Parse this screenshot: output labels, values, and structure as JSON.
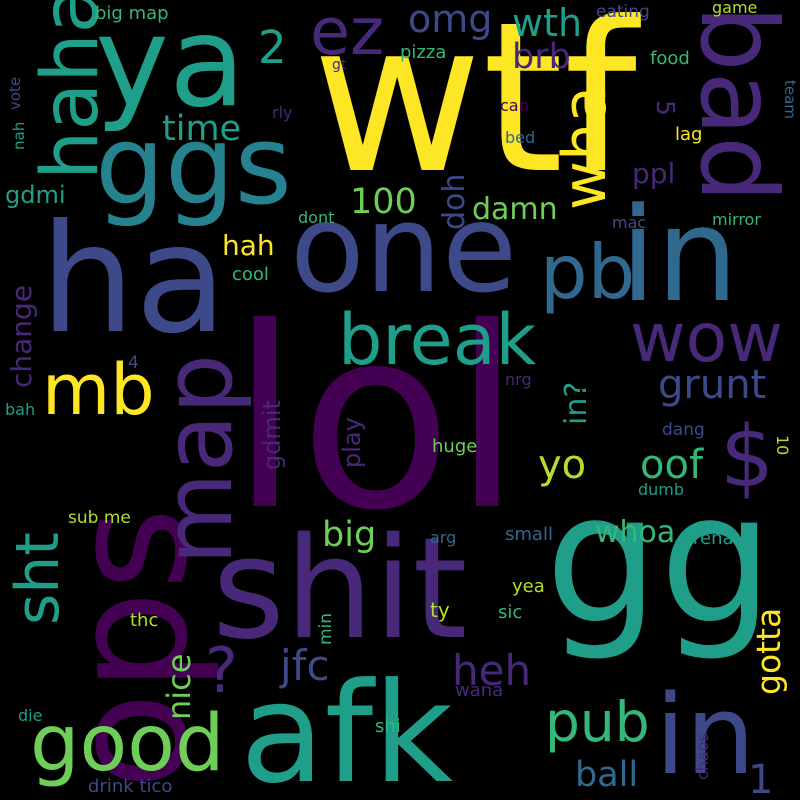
{
  "words": {
    "wtf": "wtf",
    "lol": "lol",
    "gg": "gg",
    "ops": "ops",
    "shit": "shit",
    "afk": "afk",
    "ha": "ha",
    "one": "one",
    "in_top": "in",
    "in_bottom": "in",
    "ya": "ya",
    "ggs": "ggs",
    "bad": "bad",
    "haha": "haha",
    "map": "map",
    "pb": "pb",
    "break": "break",
    "wow": "wow",
    "good": "good",
    "ez": "ez",
    "omg": "omg",
    "wth": "wth",
    "what": "wha",
    "mb": "mb",
    "dollar": "$",
    "sht": "sht",
    "pub": "pub",
    "jfc": "jfc",
    "question": "?",
    "heh": "heh",
    "grunt": "grunt",
    "oof": "oof",
    "whoa": "whoa",
    "big": "big",
    "yo": "yo",
    "ball": "ball",
    "gotta": "gotta",
    "nice": "nice",
    "change": "change",
    "gdmit": "gdmit",
    "play": "play",
    "in_q": "in?",
    "hundred": "100",
    "damn": "damn",
    "doh": "doh",
    "time": "time",
    "brb": "brb",
    "two": "2",
    "hah": "hah",
    "ppl": "ppl",
    "one_small": "1",
    "gdmi": "gdmi",
    "five": "5",
    "big_map": "big map",
    "eating": "eating",
    "game": "game",
    "pizza": "pizza",
    "food": "food",
    "gt": "gt",
    "vote": "vote",
    "nah": "nah",
    "rly": "rly",
    "cap": "cap",
    "bed": "bed",
    "lag": "lag",
    "team": "team",
    "dont": "dont",
    "mac": "mac",
    "mirror": "mirror",
    "cool": "cool",
    "four": "4",
    "nrg": "nrg",
    "bah": "bah",
    "huge": "huge",
    "dang": "dang",
    "dumb": "dumb",
    "ten": "10",
    "sub_me": "sub me",
    "arg": "arg",
    "small": "small",
    "arena": "arena",
    "yea": "yea",
    "sic": "sic",
    "thc": "thc",
    "min": "min",
    "ty": "ty",
    "die": "die",
    "shi": "shi",
    "wana": "wana",
    "chaos": "chaos",
    "drink_tico": "drink tico"
  }
}
